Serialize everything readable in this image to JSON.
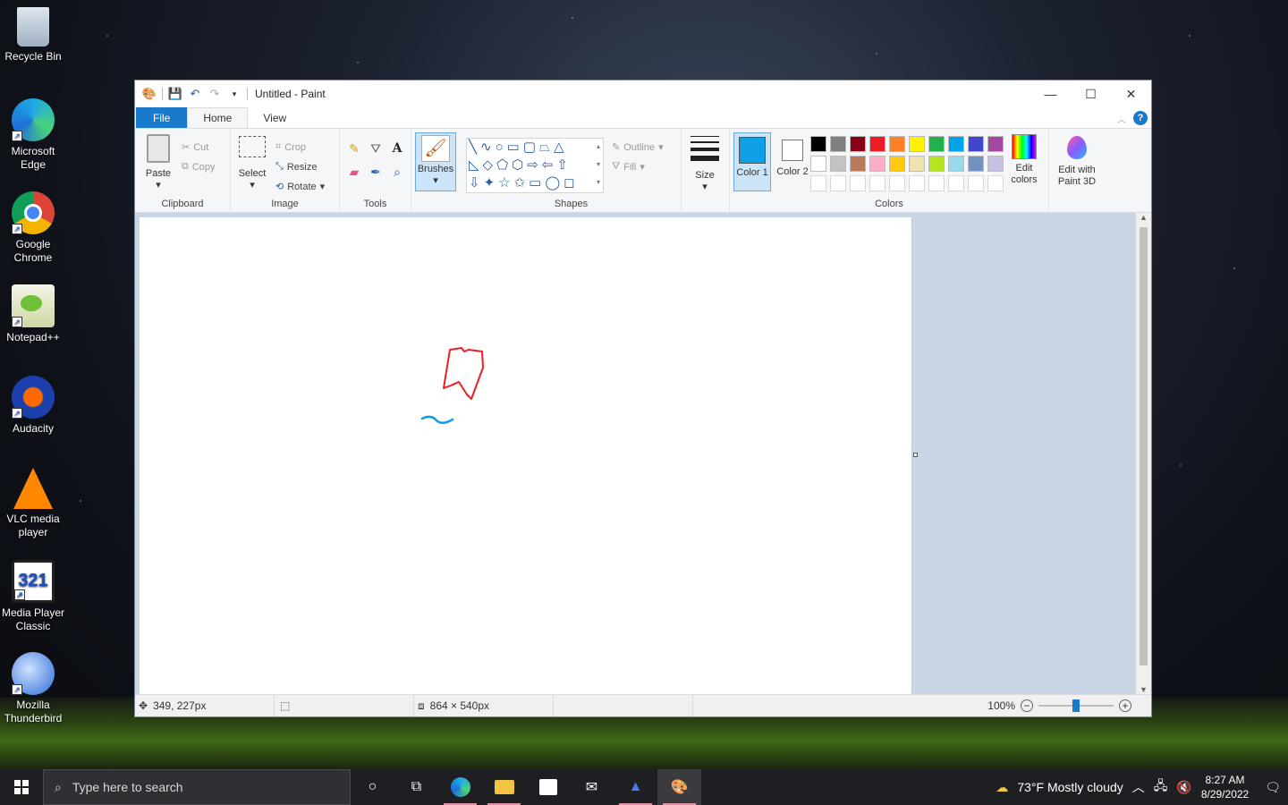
{
  "desktop": {
    "icons": [
      {
        "label": "Recycle Bin",
        "icon": "recycle-bin-icon"
      },
      {
        "label": "Microsoft Edge",
        "icon": "edge-icon"
      },
      {
        "label": "Google Chrome",
        "icon": "chrome-icon"
      },
      {
        "label": "Notepad++",
        "icon": "notepadpp-icon"
      },
      {
        "label": "Audacity",
        "icon": "audacity-icon"
      },
      {
        "label": "VLC media player",
        "icon": "vlc-icon"
      },
      {
        "label": "Media Player Classic",
        "icon": "mpc-icon"
      },
      {
        "label": "Mozilla Thunderbird",
        "icon": "thunderbird-icon"
      }
    ]
  },
  "window": {
    "title": "Untitled - Paint",
    "tabs": {
      "file": "File",
      "home": "Home",
      "view": "View"
    },
    "help": "?"
  },
  "ribbon": {
    "clipboard": {
      "paste": "Paste",
      "cut": "Cut",
      "copy": "Copy",
      "label": "Clipboard"
    },
    "image": {
      "select": "Select",
      "crop": "Crop",
      "resize": "Resize",
      "rotate": "Rotate",
      "label": "Image"
    },
    "tools": {
      "label": "Tools"
    },
    "brushes": {
      "label": "Brushes"
    },
    "shapes": {
      "outline": "Outline",
      "fill": "Fill",
      "label": "Shapes"
    },
    "size": {
      "label": "Size"
    },
    "colors": {
      "color1": "Color 1",
      "color2": "Color 2",
      "edit": "Edit colors",
      "label": "Colors",
      "color1_value": "#0ea0e6",
      "color2_value": "#ffffff",
      "palette_row1": [
        "#000000",
        "#7f7f7f",
        "#880015",
        "#ed1c24",
        "#ff7f27",
        "#fff200",
        "#22b14c",
        "#00a2e8",
        "#3f48cc",
        "#a349a4"
      ],
      "palette_row2": [
        "#ffffff",
        "#c3c3c3",
        "#b97a57",
        "#ffaec9",
        "#ffc90e",
        "#efe4b0",
        "#b5e61d",
        "#99d9ea",
        "#7092be",
        "#c8bfe7"
      ],
      "palette_row3": [
        "#ffffff",
        "#ffffff",
        "#ffffff",
        "#ffffff",
        "#ffffff",
        "#ffffff",
        "#ffffff",
        "#ffffff",
        "#ffffff",
        "#ffffff"
      ]
    },
    "paint3d": {
      "label": "Edit with Paint 3D"
    }
  },
  "status": {
    "cursor_pos": "349, 227px",
    "canvas_size": "864 × 540px",
    "zoom": "100%",
    "zoom_level": 0.5
  },
  "taskbar": {
    "search_placeholder": "Type here to search",
    "weather": "73°F  Mostly cloudy",
    "time": "8:27 AM",
    "date": "8/29/2022"
  }
}
